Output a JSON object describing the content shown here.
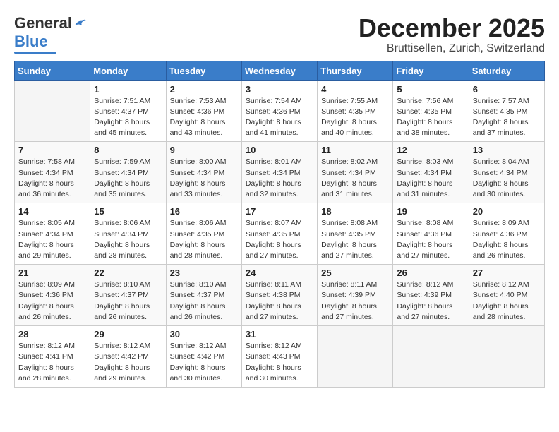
{
  "header": {
    "logo_general": "General",
    "logo_blue": "Blue",
    "month_title": "December 2025",
    "subtitle": "Bruttisellen, Zurich, Switzerland"
  },
  "days_of_week": [
    "Sunday",
    "Monday",
    "Tuesday",
    "Wednesday",
    "Thursday",
    "Friday",
    "Saturday"
  ],
  "weeks": [
    [
      {
        "day": "",
        "info": ""
      },
      {
        "day": "1",
        "info": "Sunrise: 7:51 AM\nSunset: 4:37 PM\nDaylight: 8 hours\nand 45 minutes."
      },
      {
        "day": "2",
        "info": "Sunrise: 7:53 AM\nSunset: 4:36 PM\nDaylight: 8 hours\nand 43 minutes."
      },
      {
        "day": "3",
        "info": "Sunrise: 7:54 AM\nSunset: 4:36 PM\nDaylight: 8 hours\nand 41 minutes."
      },
      {
        "day": "4",
        "info": "Sunrise: 7:55 AM\nSunset: 4:35 PM\nDaylight: 8 hours\nand 40 minutes."
      },
      {
        "day": "5",
        "info": "Sunrise: 7:56 AM\nSunset: 4:35 PM\nDaylight: 8 hours\nand 38 minutes."
      },
      {
        "day": "6",
        "info": "Sunrise: 7:57 AM\nSunset: 4:35 PM\nDaylight: 8 hours\nand 37 minutes."
      }
    ],
    [
      {
        "day": "7",
        "info": "Sunrise: 7:58 AM\nSunset: 4:34 PM\nDaylight: 8 hours\nand 36 minutes."
      },
      {
        "day": "8",
        "info": "Sunrise: 7:59 AM\nSunset: 4:34 PM\nDaylight: 8 hours\nand 35 minutes."
      },
      {
        "day": "9",
        "info": "Sunrise: 8:00 AM\nSunset: 4:34 PM\nDaylight: 8 hours\nand 33 minutes."
      },
      {
        "day": "10",
        "info": "Sunrise: 8:01 AM\nSunset: 4:34 PM\nDaylight: 8 hours\nand 32 minutes."
      },
      {
        "day": "11",
        "info": "Sunrise: 8:02 AM\nSunset: 4:34 PM\nDaylight: 8 hours\nand 31 minutes."
      },
      {
        "day": "12",
        "info": "Sunrise: 8:03 AM\nSunset: 4:34 PM\nDaylight: 8 hours\nand 31 minutes."
      },
      {
        "day": "13",
        "info": "Sunrise: 8:04 AM\nSunset: 4:34 PM\nDaylight: 8 hours\nand 30 minutes."
      }
    ],
    [
      {
        "day": "14",
        "info": "Sunrise: 8:05 AM\nSunset: 4:34 PM\nDaylight: 8 hours\nand 29 minutes."
      },
      {
        "day": "15",
        "info": "Sunrise: 8:06 AM\nSunset: 4:34 PM\nDaylight: 8 hours\nand 28 minutes."
      },
      {
        "day": "16",
        "info": "Sunrise: 8:06 AM\nSunset: 4:35 PM\nDaylight: 8 hours\nand 28 minutes."
      },
      {
        "day": "17",
        "info": "Sunrise: 8:07 AM\nSunset: 4:35 PM\nDaylight: 8 hours\nand 27 minutes."
      },
      {
        "day": "18",
        "info": "Sunrise: 8:08 AM\nSunset: 4:35 PM\nDaylight: 8 hours\nand 27 minutes."
      },
      {
        "day": "19",
        "info": "Sunrise: 8:08 AM\nSunset: 4:36 PM\nDaylight: 8 hours\nand 27 minutes."
      },
      {
        "day": "20",
        "info": "Sunrise: 8:09 AM\nSunset: 4:36 PM\nDaylight: 8 hours\nand 26 minutes."
      }
    ],
    [
      {
        "day": "21",
        "info": "Sunrise: 8:09 AM\nSunset: 4:36 PM\nDaylight: 8 hours\nand 26 minutes."
      },
      {
        "day": "22",
        "info": "Sunrise: 8:10 AM\nSunset: 4:37 PM\nDaylight: 8 hours\nand 26 minutes."
      },
      {
        "day": "23",
        "info": "Sunrise: 8:10 AM\nSunset: 4:37 PM\nDaylight: 8 hours\nand 26 minutes."
      },
      {
        "day": "24",
        "info": "Sunrise: 8:11 AM\nSunset: 4:38 PM\nDaylight: 8 hours\nand 27 minutes."
      },
      {
        "day": "25",
        "info": "Sunrise: 8:11 AM\nSunset: 4:39 PM\nDaylight: 8 hours\nand 27 minutes."
      },
      {
        "day": "26",
        "info": "Sunrise: 8:12 AM\nSunset: 4:39 PM\nDaylight: 8 hours\nand 27 minutes."
      },
      {
        "day": "27",
        "info": "Sunrise: 8:12 AM\nSunset: 4:40 PM\nDaylight: 8 hours\nand 28 minutes."
      }
    ],
    [
      {
        "day": "28",
        "info": "Sunrise: 8:12 AM\nSunset: 4:41 PM\nDaylight: 8 hours\nand 28 minutes."
      },
      {
        "day": "29",
        "info": "Sunrise: 8:12 AM\nSunset: 4:42 PM\nDaylight: 8 hours\nand 29 minutes."
      },
      {
        "day": "30",
        "info": "Sunrise: 8:12 AM\nSunset: 4:42 PM\nDaylight: 8 hours\nand 30 minutes."
      },
      {
        "day": "31",
        "info": "Sunrise: 8:12 AM\nSunset: 4:43 PM\nDaylight: 8 hours\nand 30 minutes."
      },
      {
        "day": "",
        "info": ""
      },
      {
        "day": "",
        "info": ""
      },
      {
        "day": "",
        "info": ""
      }
    ]
  ]
}
